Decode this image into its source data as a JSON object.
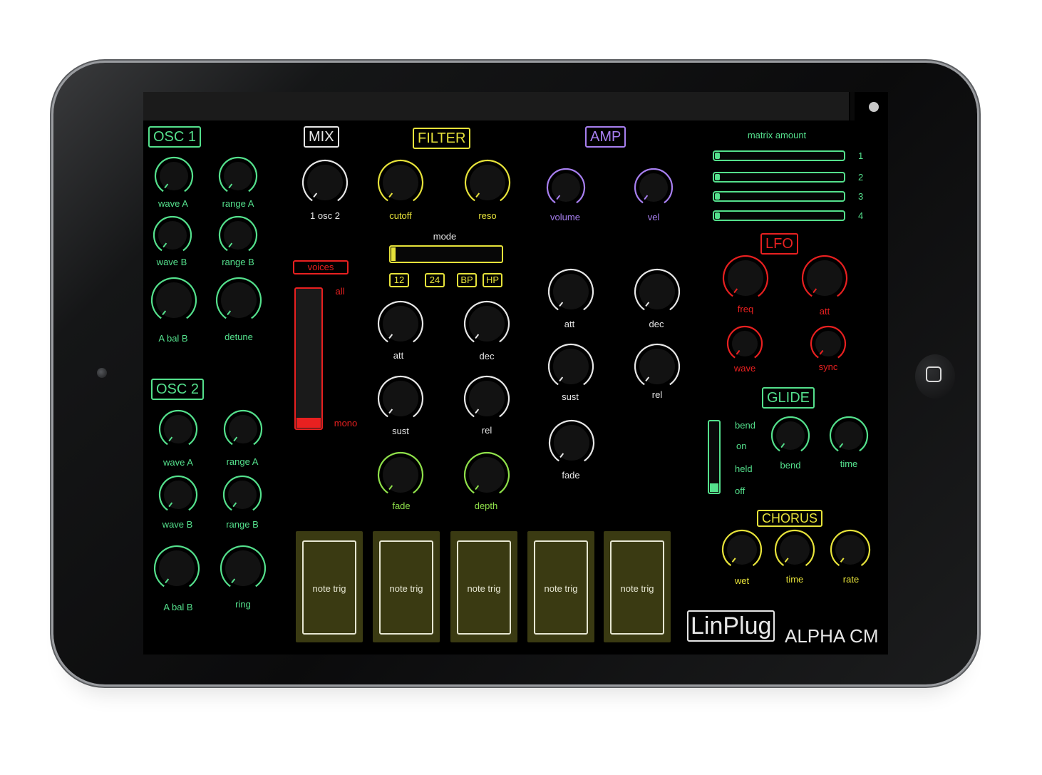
{
  "colors": {
    "osc": "#54e08c",
    "mix": "#e6e6e6",
    "filter": "#e6e23a",
    "filter_env": "#e6e6e6",
    "filter_mod": "#8fe04a",
    "amp": "#a77ff0",
    "lfo": "#e82020",
    "glide": "#54e08c",
    "chorus": "#e6e23a",
    "knob_body": "#121212"
  },
  "osc1": {
    "title": "OSC 1",
    "knobs": [
      "wave A",
      "range A",
      "wave B",
      "range B",
      "A bal B",
      "detune"
    ]
  },
  "osc2": {
    "title": "OSC 2",
    "knobs": [
      "wave A",
      "range A",
      "wave B",
      "range B",
      "A bal B",
      "ring"
    ]
  },
  "mix": {
    "title": "MIX",
    "knob": "1 osc 2"
  },
  "filter": {
    "title": "FILTER",
    "knobs": [
      "cutoff",
      "reso"
    ],
    "mode_label": "mode",
    "mode_level": 0.05,
    "mode_buttons": [
      "12",
      "24",
      "BP",
      "HP"
    ],
    "env_knobs": [
      "att",
      "dec",
      "sust",
      "rel"
    ],
    "mod_knobs": [
      "fade",
      "depth"
    ]
  },
  "voices": {
    "label": "voices",
    "top": "all",
    "bottom": "mono",
    "level": 0.0
  },
  "amp": {
    "title": "AMP",
    "knobs": [
      "volume",
      "vel"
    ],
    "env_knobs": [
      "att",
      "dec",
      "sust",
      "rel",
      "fade"
    ]
  },
  "matrix": {
    "title": "matrix amount",
    "rows": [
      {
        "num": "1",
        "level": 0.05
      },
      {
        "num": "2",
        "level": 0.05
      },
      {
        "num": "3",
        "level": 0.05
      },
      {
        "num": "4",
        "level": 0.05
      }
    ]
  },
  "lfo": {
    "title": "LFO",
    "knobs": [
      "freq",
      "att",
      "wave",
      "sync"
    ]
  },
  "glide": {
    "title": "GLIDE",
    "options": [
      "bend",
      "on",
      "held",
      "off"
    ],
    "knobs": [
      "bend",
      "time"
    ],
    "level": 0.0
  },
  "chorus": {
    "title": "CHORUS",
    "knobs": [
      "wet",
      "time",
      "rate"
    ]
  },
  "pads": [
    "note trig",
    "note trig",
    "note trig",
    "note trig",
    "note trig"
  ],
  "brand": {
    "name": "LinPlug",
    "model": "ALPHA CM"
  }
}
